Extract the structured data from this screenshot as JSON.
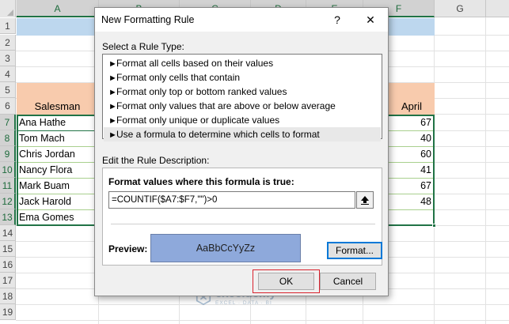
{
  "sheet": {
    "columns": [
      "A",
      "B",
      "C",
      "D",
      "E",
      "F",
      "G"
    ],
    "rows": [
      "1",
      "2",
      "3",
      "4",
      "5",
      "6",
      "7",
      "8",
      "9",
      "10",
      "11",
      "12",
      "13",
      "14",
      "15",
      "16",
      "17",
      "18",
      "19"
    ],
    "header_salesman": "Salesman",
    "header_april": "April",
    "names": [
      "Ana Hathe",
      "Tom Mach",
      "Chris Jordan",
      "Nancy Flora",
      "Mark Buam",
      "Jack Harold",
      "Ema Gomes"
    ],
    "april_values": [
      "67",
      "40",
      "60",
      "41",
      "67",
      "48",
      ""
    ]
  },
  "watermark": {
    "name": "exceldemy",
    "tagline": "EXCEL · DATA · BI"
  },
  "dialog": {
    "title": "New Formatting Rule",
    "help_glyph": "?",
    "close_glyph": "✕",
    "select_type_label": "Select a Rule Type:",
    "rule_types": [
      "Format all cells based on their values",
      "Format only cells that contain",
      "Format only top or bottom ranked values",
      "Format only values that are above or below average",
      "Format only unique or duplicate values",
      "Use a formula to determine which cells to format"
    ],
    "selected_rule_index": 5,
    "edit_desc_label": "Edit the Rule Description:",
    "formula_label": "Format values where this formula is true:",
    "formula_value": "=COUNTIF($A7:$F7,\"\")>0",
    "preview_label": "Preview:",
    "preview_text": "AaBbCcYyZz",
    "format_button": "Format...",
    "ok_button": "OK",
    "cancel_button": "Cancel"
  },
  "colors": {
    "accent_green": "#217346",
    "preview_fill": "#8ea9db",
    "header_band_blue": "#bdd7ee",
    "header_band_orange": "#f8cbad",
    "ok_highlight": "#d9232e"
  }
}
